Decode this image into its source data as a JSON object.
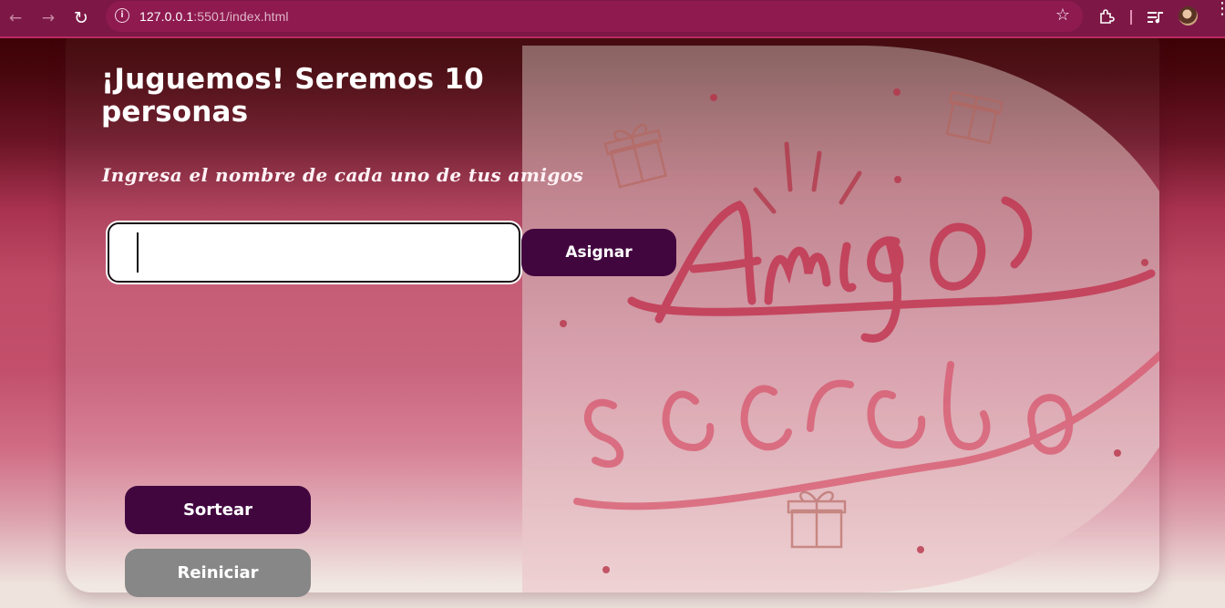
{
  "browser": {
    "url_host": "127.0.0.1",
    "url_path": ":5501/index.html"
  },
  "page": {
    "title": "¡Juguemos! Seremos 10 personas",
    "subtitle": "Ingresa el nombre de cada uno de tus amigos",
    "name_input": {
      "value": "",
      "placeholder": ""
    },
    "assign_label": "Asignar",
    "draw_label": "Sortear",
    "reset_label": "Reiniciar",
    "hero_image": {
      "logo_text": "Amigo secreto"
    }
  },
  "colors": {
    "primary_button": "#42063f",
    "secondary_button": "#878787",
    "browser_chrome": "#7d1846"
  }
}
